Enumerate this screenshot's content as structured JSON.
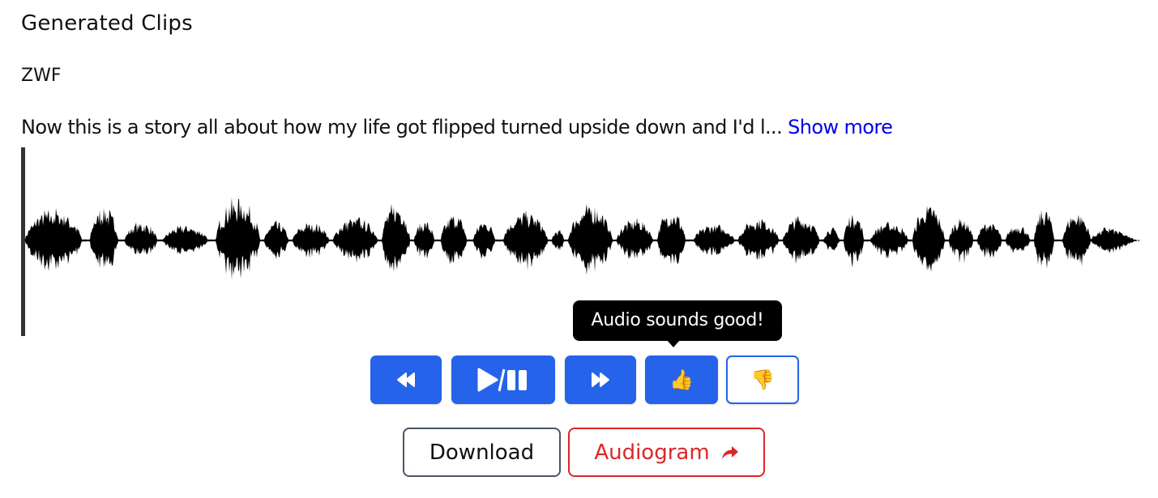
{
  "page": {
    "title": "Generated Clips",
    "voice_name": "ZWF",
    "description": "Now this is a story all about how my life got flipped turned upside down and I'd l...",
    "show_more_label": "Show more"
  },
  "player": {
    "playhead_progress": 0,
    "waveform_color": "#000000",
    "cursor_color": "#333333",
    "controls": [
      {
        "name": "rewind",
        "icon": "rewind-icon"
      },
      {
        "name": "play-pause",
        "icon": "play-pause-icon"
      },
      {
        "name": "fast-forward",
        "icon": "fast-forward-icon"
      },
      {
        "name": "thumbs-up",
        "icon": "thumbs-up-icon",
        "glyph": "👍",
        "selected": true
      },
      {
        "name": "thumbs-down",
        "icon": "thumbs-down-icon",
        "glyph": "👎",
        "selected": false
      }
    ],
    "tooltip": "Audio sounds good!"
  },
  "actions": {
    "download_label": "Download",
    "audiogram_label": "Audiogram"
  },
  "colors": {
    "primary": "#2563eb",
    "danger": "#dc2626",
    "link": "#0000ee"
  }
}
